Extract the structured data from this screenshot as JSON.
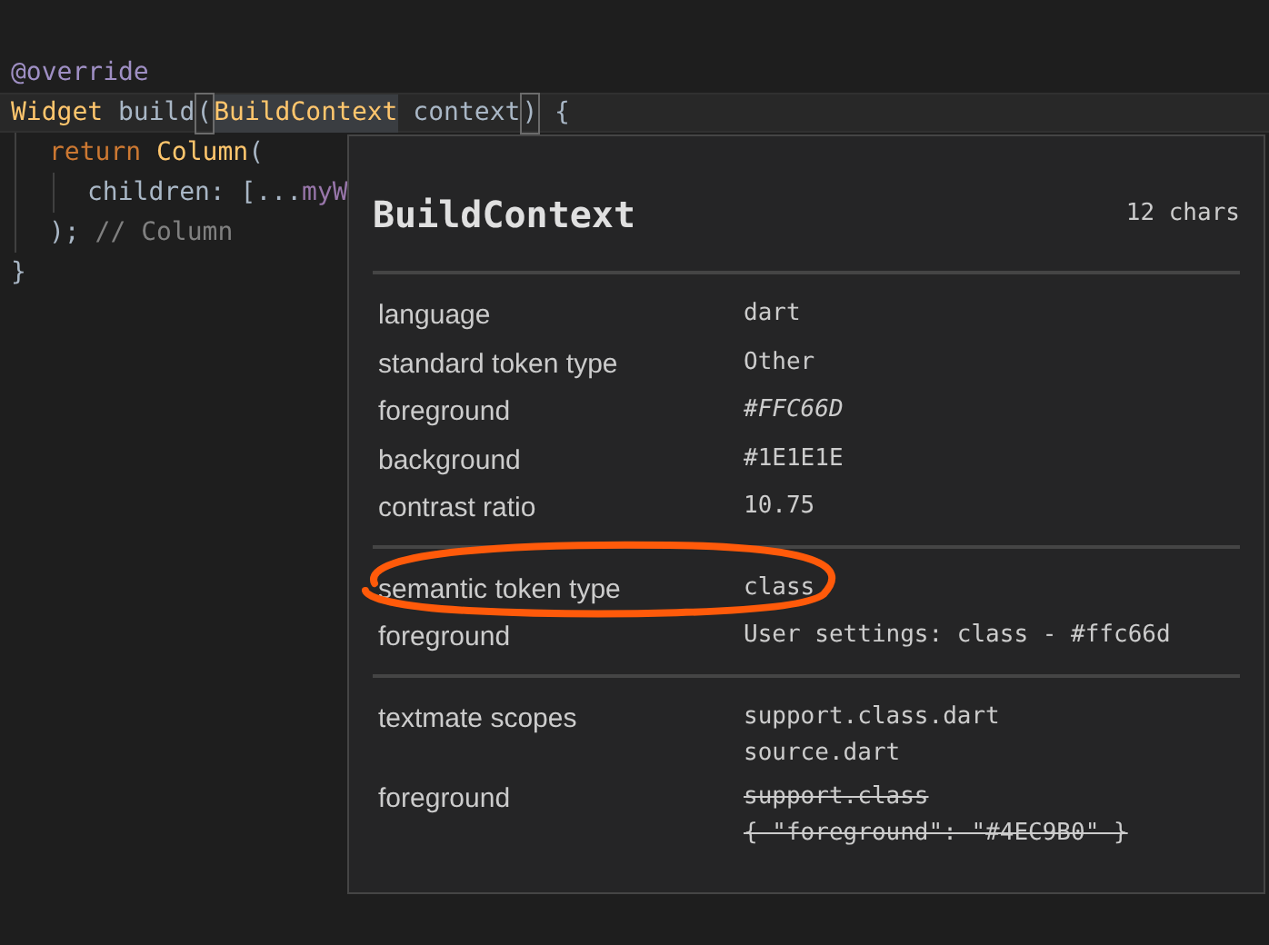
{
  "editor": {
    "lines": [
      {
        "current": false,
        "tokens": [
          {
            "kind": "annotation",
            "text": "@override"
          }
        ]
      },
      {
        "current": true,
        "tokens": [
          {
            "kind": "class",
            "text": "Widget"
          },
          {
            "kind": "plain",
            "text": " build"
          },
          {
            "kind": "bracket",
            "text": "("
          },
          {
            "kind": "class",
            "text": "BuildContext",
            "selected": true
          },
          {
            "kind": "plain",
            "text": " context"
          },
          {
            "kind": "bracket",
            "text": ")"
          },
          {
            "kind": "plain",
            "text": " {"
          }
        ],
        "children": [
          {
            "current": false,
            "tokens": [
              {
                "kind": "keyword",
                "text": "return"
              },
              {
                "kind": "class",
                "text": " Column"
              },
              {
                "kind": "plain",
                "text": "("
              }
            ],
            "children": [
              {
                "current": false,
                "tokens": [
                  {
                    "kind": "plain",
                    "text": "children: [..."
                  },
                  {
                    "kind": "field",
                    "text": "myW"
                  }
                ]
              }
            ]
          },
          {
            "current": false,
            "tokens": [
              {
                "kind": "plain",
                "text": ");"
              },
              {
                "kind": "comment",
                "text": " // Column"
              }
            ]
          }
        ]
      },
      {
        "current": false,
        "tokens": [
          {
            "kind": "plain",
            "text": "}"
          }
        ]
      }
    ]
  },
  "hover": {
    "title": "BuildContext",
    "length": "12 chars",
    "sections": [
      [
        {
          "label": "language",
          "value": [
            "dart"
          ],
          "kind": "plain"
        },
        {
          "label": "standard token type",
          "value": [
            "Other"
          ],
          "kind": "plain"
        },
        {
          "label": "foreground",
          "value": [
            "#FFC66D"
          ],
          "kind": "emphasized"
        },
        {
          "label": "background",
          "value": [
            "#1E1E1E"
          ],
          "kind": "plain"
        },
        {
          "label": "contrast ratio",
          "value": [
            "10.75"
          ],
          "kind": "plain"
        }
      ],
      [
        {
          "label": "semantic token type",
          "value": [
            "class"
          ],
          "kind": "plain"
        },
        {
          "label": "foreground",
          "value": [
            "User settings: class - #ffc66d"
          ],
          "kind": "plain"
        }
      ],
      [
        {
          "label": "textmate scopes",
          "value": [
            "support.class.dart",
            "source.dart"
          ],
          "kind": "plain"
        },
        {
          "label": "foreground",
          "value": [
            "support.class",
            "{ \"foreground\": \"#4EC9B0\" }"
          ],
          "kind": "struck"
        }
      ]
    ]
  }
}
